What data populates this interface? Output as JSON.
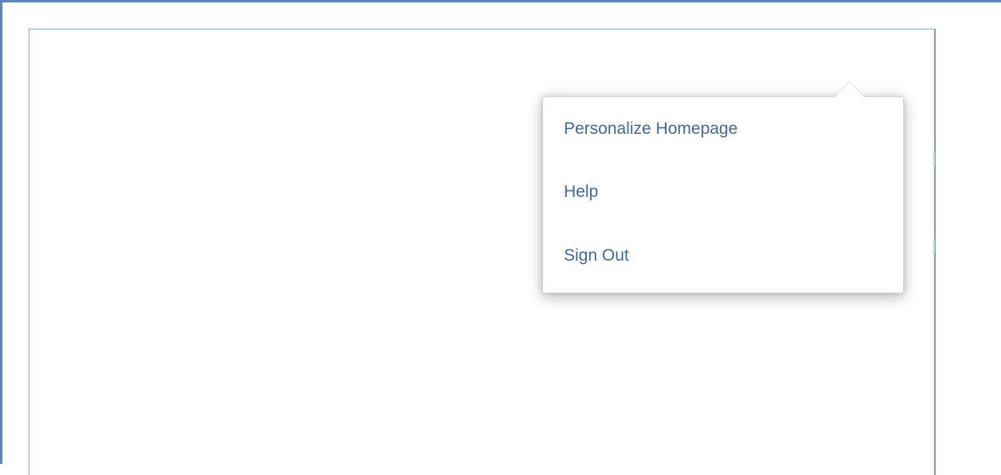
{
  "user_menu": {
    "items": [
      {
        "label": "Personalize Homepage"
      },
      {
        "label": "Help"
      },
      {
        "label": "Sign Out"
      }
    ]
  },
  "colors": {
    "frame_border": "#5b86c5",
    "menu_link": "#3d6a9e"
  }
}
